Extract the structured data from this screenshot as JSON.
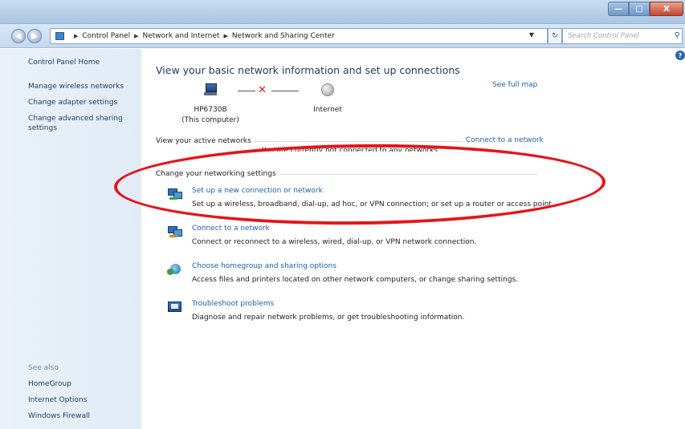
{
  "window": {
    "buttons": {
      "minimize": "—",
      "maximize": "□",
      "close": "X"
    }
  },
  "address": {
    "crumbs": [
      "Control Panel",
      "Network and Internet",
      "Network and Sharing Center"
    ],
    "search_placeholder": "Search Control Panel"
  },
  "sidebar": {
    "home": "Control Panel Home",
    "links": [
      "Manage wireless networks",
      "Change adapter settings",
      "Change advanced sharing settings"
    ],
    "see_also_title": "See also",
    "see_also": [
      "HomeGroup",
      "Internet Options",
      "Windows Firewall"
    ]
  },
  "main": {
    "title": "View your basic network information and set up connections",
    "see_full_map": "See full map",
    "computer_name": "HP6730B",
    "computer_sub": "(This computer)",
    "internet": "Internet",
    "active_networks_label": "View your active networks",
    "connect_link": "Connect to a network",
    "not_connected_text": "You are currently not connected to any networks.",
    "change_settings_label": "Change your networking settings",
    "tasks": [
      {
        "link": "Set up a new connection or network",
        "desc": "Set up a wireless, broadband, dial-up, ad hoc, or VPN connection; or set up a router or access point."
      },
      {
        "link": "Connect to a network",
        "desc": "Connect or reconnect to a wireless, wired, dial-up, or VPN network connection."
      },
      {
        "link": "Choose homegroup and sharing options",
        "desc": "Access files and printers located on other network computers, or change sharing settings."
      },
      {
        "link": "Troubleshoot problems",
        "desc": "Diagnose and repair network problems, or get troubleshooting information."
      }
    ]
  },
  "colors": {
    "highlight_ellipse": "#e3161a",
    "link": "#1f5fa8",
    "disconnected_x": "#d21f1f"
  }
}
